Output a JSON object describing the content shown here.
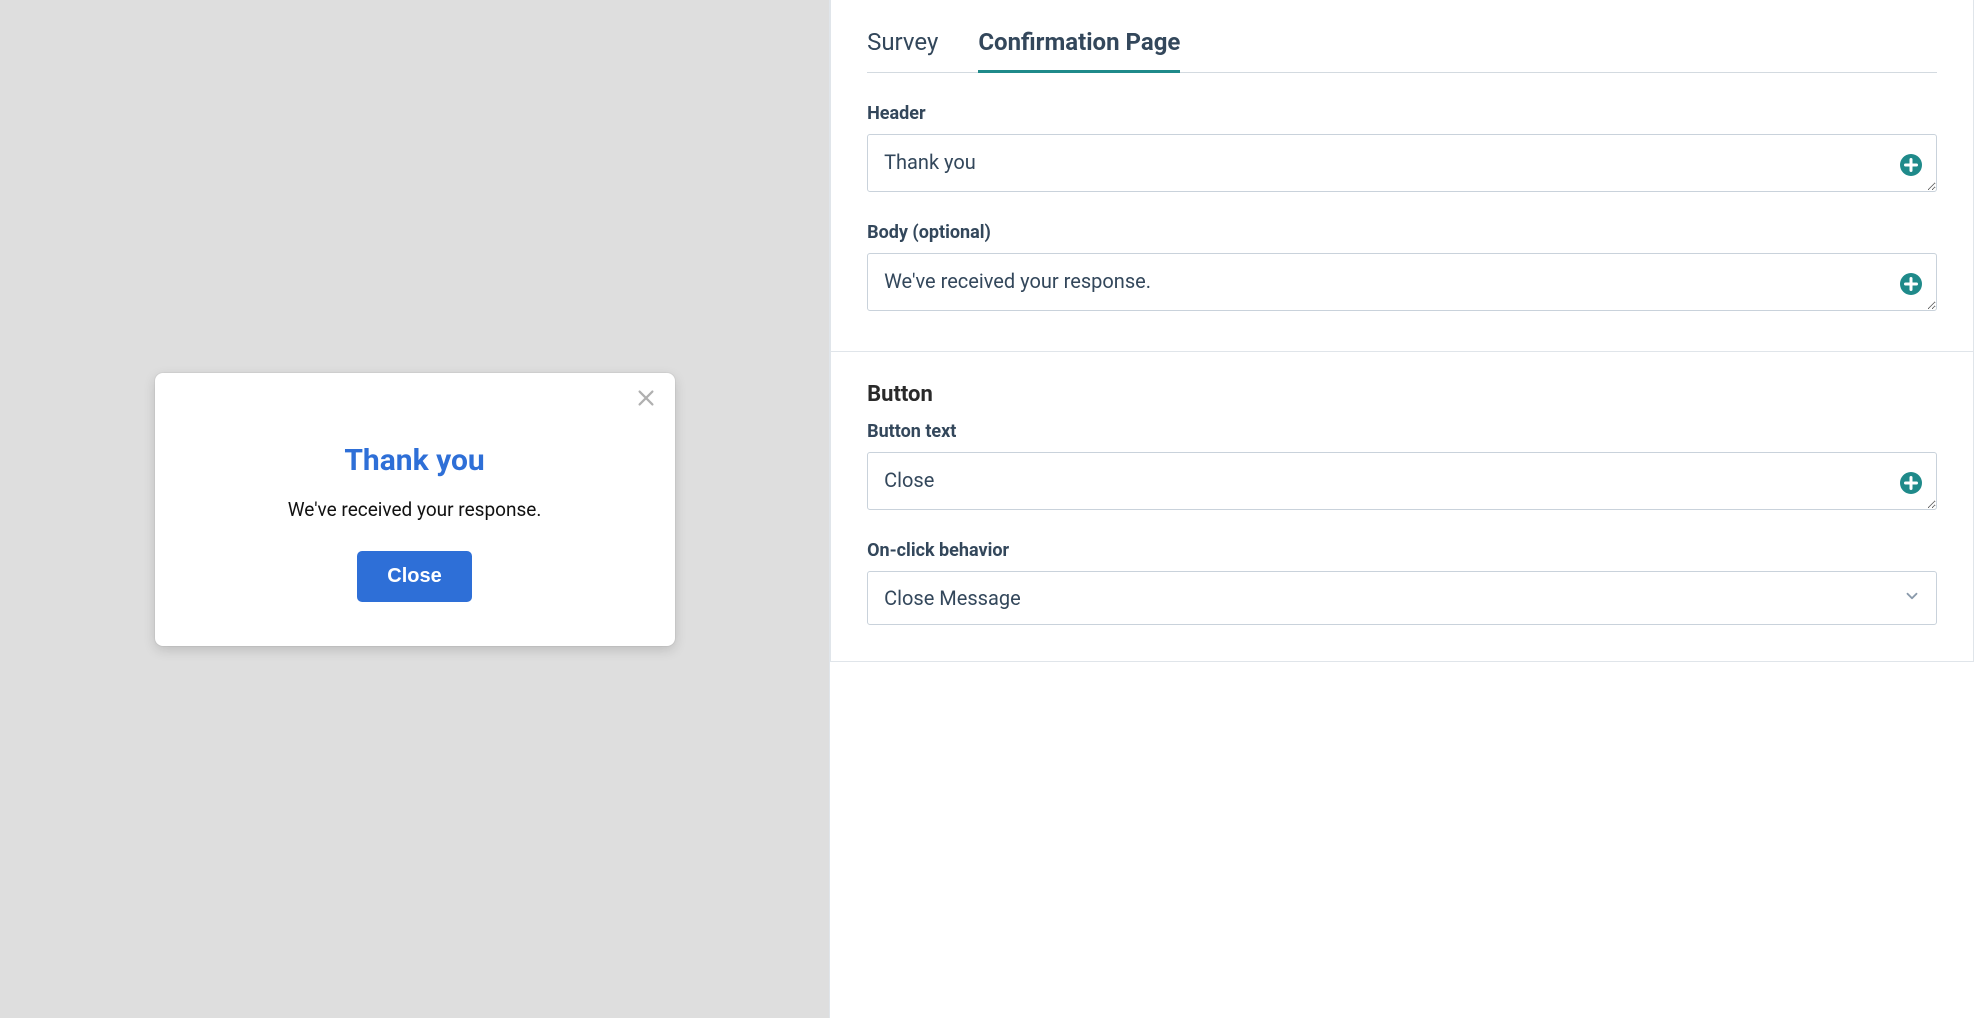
{
  "tabs": {
    "survey": "Survey",
    "confirmation": "Confirmation Page",
    "active": "confirmation"
  },
  "fields": {
    "header_label": "Header",
    "header_value": "Thank you",
    "body_label": "Body (optional)",
    "body_value": "We've received your response.",
    "button_section_title": "Button",
    "button_text_label": "Button text",
    "button_text_value": "Close",
    "onclick_label": "On-click behavior",
    "onclick_value": "Close Message"
  },
  "preview": {
    "header": "Thank you",
    "body": "We've received your response.",
    "button": "Close"
  }
}
